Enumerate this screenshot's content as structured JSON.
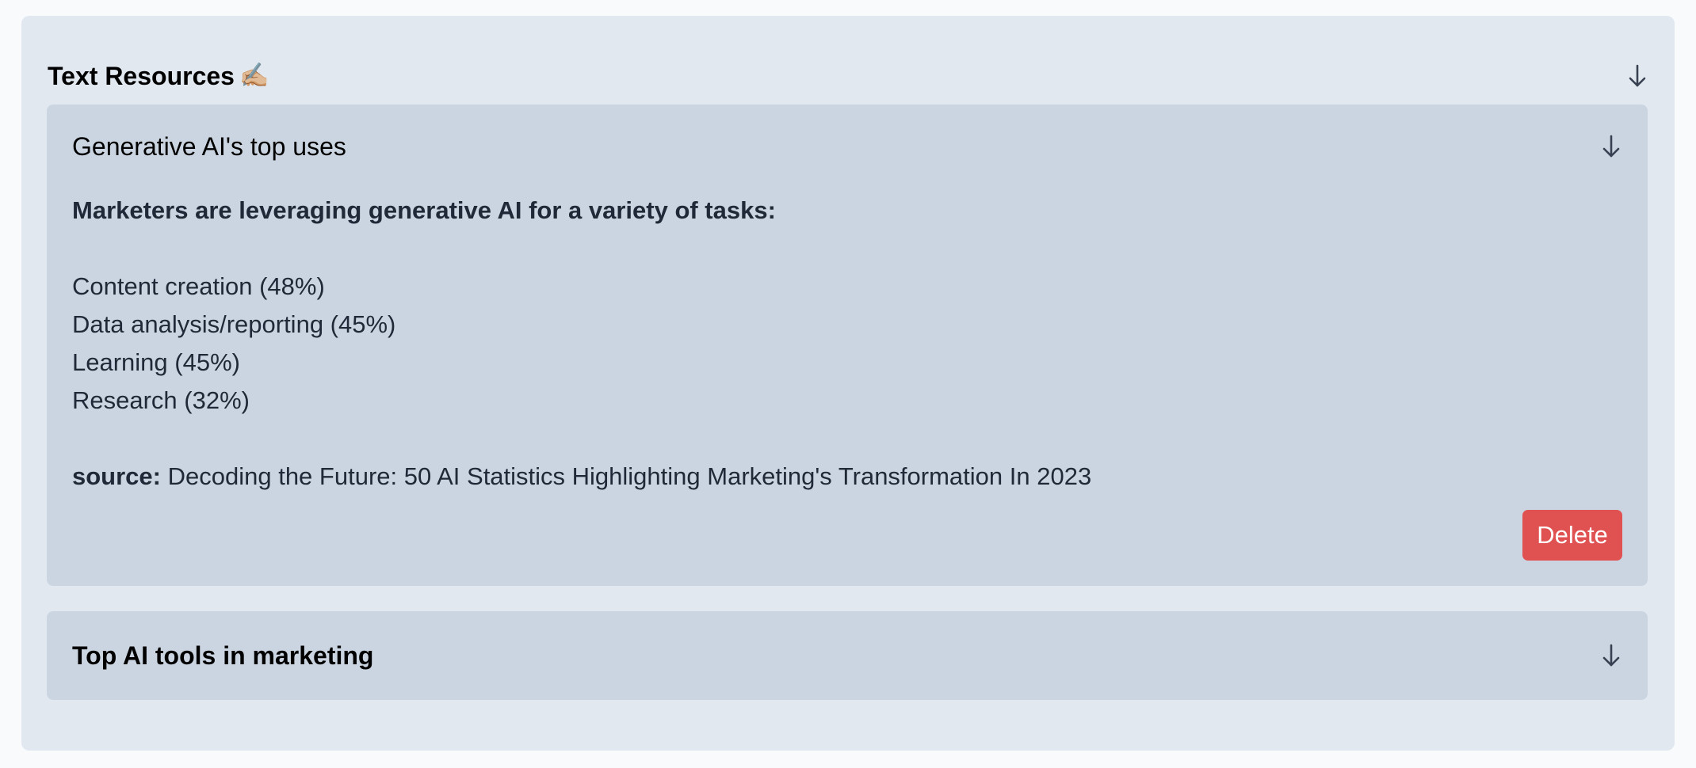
{
  "section": {
    "title": "Text Resources",
    "title_icon": "✍🏼",
    "icon": "arrow-down-icon"
  },
  "resources": [
    {
      "title": "Generative AI's top uses",
      "intro": "Marketers are leveraging generative AI for a variety of tasks:",
      "items": [
        "Content creation (48%)",
        "Data analysis/reporting (45%)",
        "Learning (45%)",
        "Research (32%)"
      ],
      "source_label": "source:",
      "source_text": "Decoding the Future: 50 AI Statistics Highlighting Marketing's Transformation In 2023",
      "delete_label": "Delete",
      "delete_color": "#e05252"
    },
    {
      "title": "Top AI tools in marketing"
    }
  ],
  "colors": {
    "page_bg": "#f8fafc",
    "section_bg": "#e2e8f0",
    "card_bg": "#cbd5e1"
  }
}
